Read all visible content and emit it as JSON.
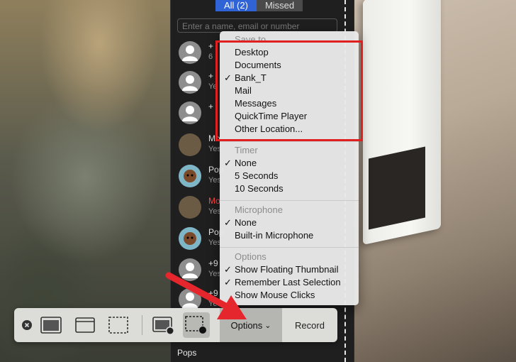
{
  "contacts": {
    "segment_all": "All (2)",
    "segment_missed": "Missed",
    "search_placeholder": "Enter a name, email or number",
    "rows": [
      {
        "name": "+",
        "sub": "6"
      },
      {
        "name": "+",
        "sub": "Ye"
      },
      {
        "name": "+",
        "sub": ""
      },
      {
        "name": "Mo",
        "sub": "Yes"
      },
      {
        "name": "Pop",
        "sub": "Yes"
      },
      {
        "name": "Mo",
        "sub": "Yes"
      },
      {
        "name": "Pop",
        "sub": "Yes"
      },
      {
        "name": "+9",
        "sub": "Yes"
      },
      {
        "name": "+9",
        "sub": "Yes"
      }
    ],
    "bottom_name": "Pops"
  },
  "menu": {
    "save_to_header": "Save to",
    "save_items": [
      "Desktop",
      "Documents",
      "Bank_T",
      "Mail",
      "Messages",
      "QuickTime Player",
      "Other Location..."
    ],
    "save_checked_index": 2,
    "timer_header": "Timer",
    "timer_items": [
      "None",
      "5 Seconds",
      "10 Seconds"
    ],
    "microphone_header": "Microphone",
    "mic_items": [
      "None",
      "Built-in Microphone"
    ],
    "options_header": "Options",
    "option_items": [
      "Show Floating Thumbnail",
      "Remember Last Selection",
      "Show Mouse Clicks"
    ],
    "checkmark": "✓"
  },
  "toolbar": {
    "options_label": "Options",
    "options_chevron": "⌄",
    "record_label": "Record",
    "close_glyph": "✕"
  },
  "colors": {
    "highlight": "#e02020",
    "arrow": "#e6262d",
    "segment_active": "#2f63d6"
  }
}
